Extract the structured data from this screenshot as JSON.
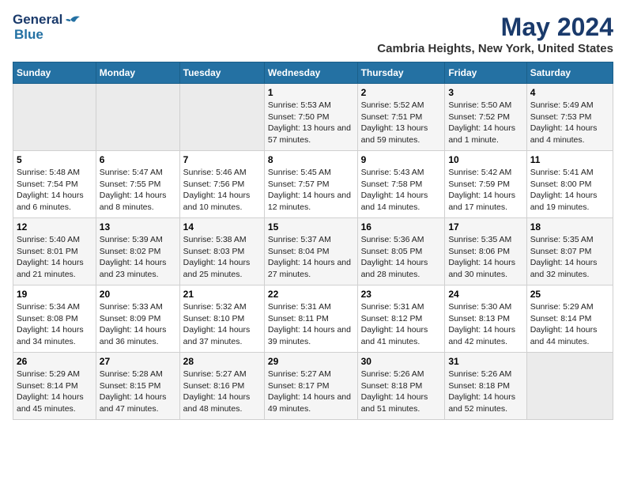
{
  "header": {
    "logo_line1": "General",
    "logo_line2": "Blue",
    "title": "May 2024",
    "subtitle": "Cambria Heights, New York, United States"
  },
  "weekdays": [
    "Sunday",
    "Monday",
    "Tuesday",
    "Wednesday",
    "Thursday",
    "Friday",
    "Saturday"
  ],
  "rows": [
    [
      {
        "day": "",
        "content": "",
        "empty": true
      },
      {
        "day": "",
        "content": "",
        "empty": true
      },
      {
        "day": "",
        "content": "",
        "empty": true
      },
      {
        "day": "1",
        "content": "Sunrise: 5:53 AM\nSunset: 7:50 PM\nDaylight: 13 hours and 57 minutes.",
        "empty": false
      },
      {
        "day": "2",
        "content": "Sunrise: 5:52 AM\nSunset: 7:51 PM\nDaylight: 13 hours and 59 minutes.",
        "empty": false
      },
      {
        "day": "3",
        "content": "Sunrise: 5:50 AM\nSunset: 7:52 PM\nDaylight: 14 hours and 1 minute.",
        "empty": false
      },
      {
        "day": "4",
        "content": "Sunrise: 5:49 AM\nSunset: 7:53 PM\nDaylight: 14 hours and 4 minutes.",
        "empty": false
      }
    ],
    [
      {
        "day": "5",
        "content": "Sunrise: 5:48 AM\nSunset: 7:54 PM\nDaylight: 14 hours and 6 minutes.",
        "empty": false
      },
      {
        "day": "6",
        "content": "Sunrise: 5:47 AM\nSunset: 7:55 PM\nDaylight: 14 hours and 8 minutes.",
        "empty": false
      },
      {
        "day": "7",
        "content": "Sunrise: 5:46 AM\nSunset: 7:56 PM\nDaylight: 14 hours and 10 minutes.",
        "empty": false
      },
      {
        "day": "8",
        "content": "Sunrise: 5:45 AM\nSunset: 7:57 PM\nDaylight: 14 hours and 12 minutes.",
        "empty": false
      },
      {
        "day": "9",
        "content": "Sunrise: 5:43 AM\nSunset: 7:58 PM\nDaylight: 14 hours and 14 minutes.",
        "empty": false
      },
      {
        "day": "10",
        "content": "Sunrise: 5:42 AM\nSunset: 7:59 PM\nDaylight: 14 hours and 17 minutes.",
        "empty": false
      },
      {
        "day": "11",
        "content": "Sunrise: 5:41 AM\nSunset: 8:00 PM\nDaylight: 14 hours and 19 minutes.",
        "empty": false
      }
    ],
    [
      {
        "day": "12",
        "content": "Sunrise: 5:40 AM\nSunset: 8:01 PM\nDaylight: 14 hours and 21 minutes.",
        "empty": false
      },
      {
        "day": "13",
        "content": "Sunrise: 5:39 AM\nSunset: 8:02 PM\nDaylight: 14 hours and 23 minutes.",
        "empty": false
      },
      {
        "day": "14",
        "content": "Sunrise: 5:38 AM\nSunset: 8:03 PM\nDaylight: 14 hours and 25 minutes.",
        "empty": false
      },
      {
        "day": "15",
        "content": "Sunrise: 5:37 AM\nSunset: 8:04 PM\nDaylight: 14 hours and 27 minutes.",
        "empty": false
      },
      {
        "day": "16",
        "content": "Sunrise: 5:36 AM\nSunset: 8:05 PM\nDaylight: 14 hours and 28 minutes.",
        "empty": false
      },
      {
        "day": "17",
        "content": "Sunrise: 5:35 AM\nSunset: 8:06 PM\nDaylight: 14 hours and 30 minutes.",
        "empty": false
      },
      {
        "day": "18",
        "content": "Sunrise: 5:35 AM\nSunset: 8:07 PM\nDaylight: 14 hours and 32 minutes.",
        "empty": false
      }
    ],
    [
      {
        "day": "19",
        "content": "Sunrise: 5:34 AM\nSunset: 8:08 PM\nDaylight: 14 hours and 34 minutes.",
        "empty": false
      },
      {
        "day": "20",
        "content": "Sunrise: 5:33 AM\nSunset: 8:09 PM\nDaylight: 14 hours and 36 minutes.",
        "empty": false
      },
      {
        "day": "21",
        "content": "Sunrise: 5:32 AM\nSunset: 8:10 PM\nDaylight: 14 hours and 37 minutes.",
        "empty": false
      },
      {
        "day": "22",
        "content": "Sunrise: 5:31 AM\nSunset: 8:11 PM\nDaylight: 14 hours and 39 minutes.",
        "empty": false
      },
      {
        "day": "23",
        "content": "Sunrise: 5:31 AM\nSunset: 8:12 PM\nDaylight: 14 hours and 41 minutes.",
        "empty": false
      },
      {
        "day": "24",
        "content": "Sunrise: 5:30 AM\nSunset: 8:13 PM\nDaylight: 14 hours and 42 minutes.",
        "empty": false
      },
      {
        "day": "25",
        "content": "Sunrise: 5:29 AM\nSunset: 8:14 PM\nDaylight: 14 hours and 44 minutes.",
        "empty": false
      }
    ],
    [
      {
        "day": "26",
        "content": "Sunrise: 5:29 AM\nSunset: 8:14 PM\nDaylight: 14 hours and 45 minutes.",
        "empty": false
      },
      {
        "day": "27",
        "content": "Sunrise: 5:28 AM\nSunset: 8:15 PM\nDaylight: 14 hours and 47 minutes.",
        "empty": false
      },
      {
        "day": "28",
        "content": "Sunrise: 5:27 AM\nSunset: 8:16 PM\nDaylight: 14 hours and 48 minutes.",
        "empty": false
      },
      {
        "day": "29",
        "content": "Sunrise: 5:27 AM\nSunset: 8:17 PM\nDaylight: 14 hours and 49 minutes.",
        "empty": false
      },
      {
        "day": "30",
        "content": "Sunrise: 5:26 AM\nSunset: 8:18 PM\nDaylight: 14 hours and 51 minutes.",
        "empty": false
      },
      {
        "day": "31",
        "content": "Sunrise: 5:26 AM\nSunset: 8:18 PM\nDaylight: 14 hours and 52 minutes.",
        "empty": false
      },
      {
        "day": "",
        "content": "",
        "empty": true
      }
    ]
  ]
}
